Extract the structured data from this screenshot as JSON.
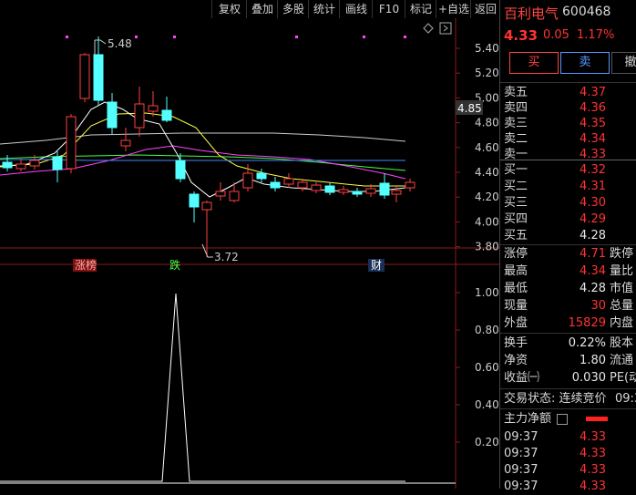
{
  "toolbar": {
    "items": [
      "复权",
      "叠加",
      "多股",
      "统计",
      "画线",
      "F10",
      "标记",
      "+自选",
      "返回"
    ]
  },
  "stock": {
    "name": "百利电气",
    "code": "600468",
    "price": "4.33",
    "change": "0.05",
    "pct": "1.17%"
  },
  "trade_buttons": {
    "buy": "买",
    "sell": "卖",
    "cancel": "撤"
  },
  "chart": {
    "price_axis": [
      "5.40",
      "5.20",
      "5.00",
      "4.80",
      "4.60",
      "4.40",
      "4.20",
      "4.00",
      "3.80"
    ],
    "current_price_tag": "4.85",
    "high_label": "5.48",
    "low_label": "3.72",
    "markers": [
      "涨榜",
      "跌",
      "财"
    ],
    "indicator_axis": [
      "1.00",
      "0.80",
      "0.60",
      "0.40",
      "0.20"
    ],
    "colors": {
      "up": "#ff4040",
      "down": "#54ffff",
      "ma5": "#ffffff",
      "ma10": "#ffff44",
      "ma20": "#ff44ff",
      "ma30": "#44ff44",
      "ma60": "#cccccc"
    }
  },
  "orderbook": {
    "sell": [
      {
        "label": "卖五",
        "price": "4.37"
      },
      {
        "label": "卖四",
        "price": "4.36"
      },
      {
        "label": "卖三",
        "price": "4.35"
      },
      {
        "label": "卖二",
        "price": "4.34"
      },
      {
        "label": "卖一",
        "price": "4.33"
      }
    ],
    "buy": [
      {
        "label": "买一",
        "price": "4.32"
      },
      {
        "label": "买二",
        "price": "4.31"
      },
      {
        "label": "买三",
        "price": "4.30"
      },
      {
        "label": "买四",
        "price": "4.29"
      },
      {
        "label": "买五",
        "price": "4.28"
      }
    ]
  },
  "stats": [
    {
      "label": "涨停",
      "value": "4.71",
      "label2": "跌停",
      "color": "red"
    },
    {
      "label": "最高",
      "value": "4.34",
      "label2": "量比",
      "color": "red"
    },
    {
      "label": "最低",
      "value": "4.28",
      "label2": "市值",
      "color": "white"
    },
    {
      "label": "现量",
      "value": "30",
      "label2": "总量",
      "color": "red"
    },
    {
      "label": "外盘",
      "value": "15829",
      "label2": "内盘",
      "color": "red"
    }
  ],
  "stats2": [
    {
      "label": "换手",
      "value": "0.22%",
      "label2": "股本"
    },
    {
      "label": "净资",
      "value": "1.80",
      "label2": "流通"
    },
    {
      "label": "收益㈠",
      "value": "0.030",
      "label2": "PE(动"
    }
  ],
  "status": {
    "label": "交易状态: 连续竞价",
    "time": "09:3"
  },
  "main_net": {
    "label": "主力净额"
  },
  "ticks": [
    {
      "time": "09:37",
      "price": "4.33"
    },
    {
      "time": "09:37",
      "price": "4.33"
    },
    {
      "time": "09:37",
      "price": "4.33"
    },
    {
      "time": "09:37",
      "price": "4.33"
    }
  ]
}
